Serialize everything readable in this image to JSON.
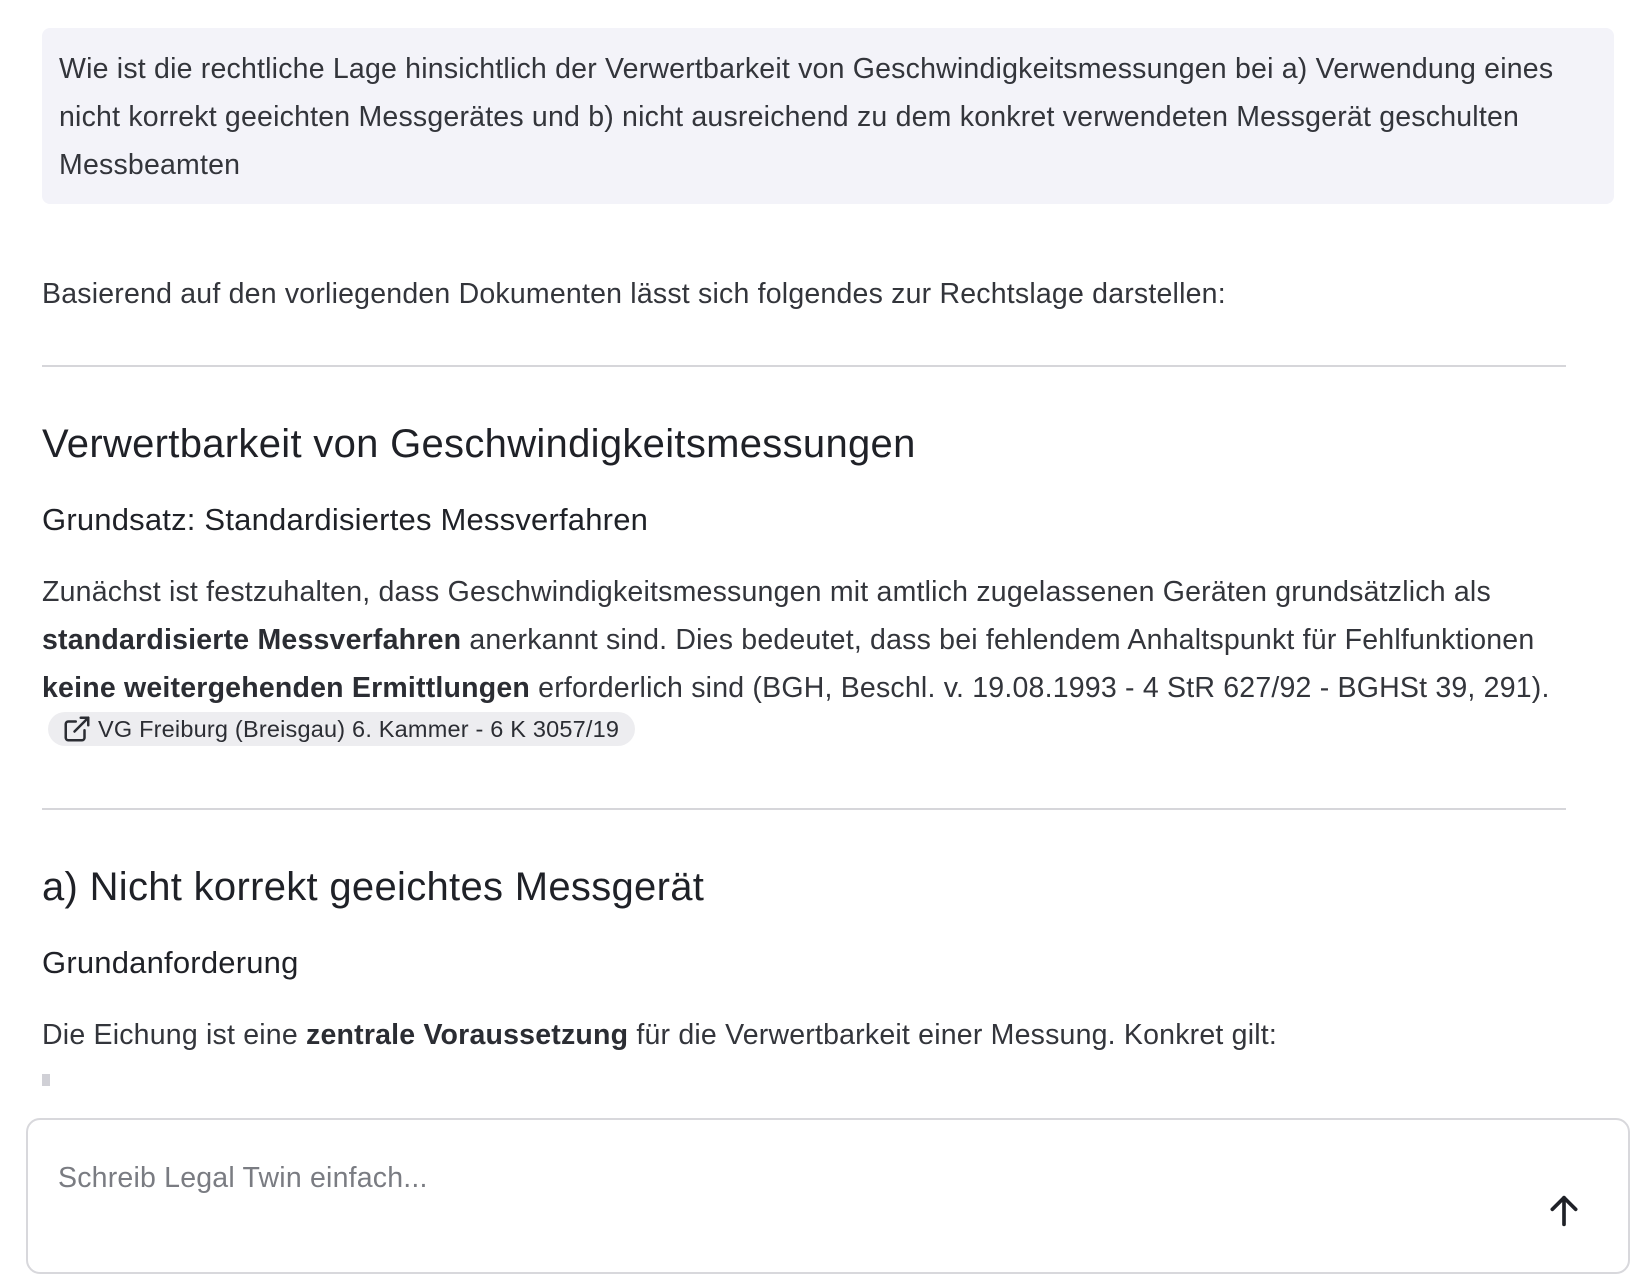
{
  "question": {
    "text": "Wie ist die rechtliche Lage hinsichtlich der Verwertbarkeit von Geschwindigkeitsmessungen bei a) Verwendung eines nicht korrekt geeichten Messgerätes und b) nicht ausreichend zu dem konkret verwendeten Messgerät geschulten Messbeamten"
  },
  "answer": {
    "intro": "Basierend auf den vorliegenden Dokumenten lässt sich folgendes zur Rechtslage darstellen:",
    "section1": {
      "heading": "Verwertbarkeit von Geschwindigkeitsmessungen",
      "subheading": "Grundsatz: Standardisiertes Messverfahren",
      "p_part1": "Zunächst ist festzuhalten, dass Geschwindigkeitsmessungen mit amtlich zugelassenen Geräten grundsätzlich als ",
      "p_bold1": "standardisierte Messverfahren",
      "p_part2": " anerkannt sind. Dies bedeutet, dass bei fehlendem Anhaltspunkt für Fehlfunktionen ",
      "p_bold2": "keine weitergehenden Ermittlungen",
      "p_part3": " erforderlich sind (BGH, Beschl. v. 19.08.1993 - 4 StR 627/92 - BGHSt 39, 291).",
      "citation": {
        "icon": "external-link-icon",
        "label": "VG Freiburg (Breisgau) 6. Kammer - 6 K 3057/19"
      }
    },
    "section2": {
      "heading": "a) Nicht korrekt geeichtes Messgerät",
      "subheading": "Grundanforderung",
      "p_part1": "Die Eichung ist eine ",
      "p_bold1": "zentrale Voraussetzung",
      "p_part2": " für die Verwertbarkeit einer Messung. Konkret gilt:"
    }
  },
  "composer": {
    "placeholder": "Schreib Legal Twin einfach...",
    "value": "",
    "send_icon": "arrow-up-icon"
  },
  "colors": {
    "question_bg": "#f3f3f9",
    "chip_bg": "#ededf0",
    "divider": "#d6d6da",
    "text": "#33353b"
  }
}
